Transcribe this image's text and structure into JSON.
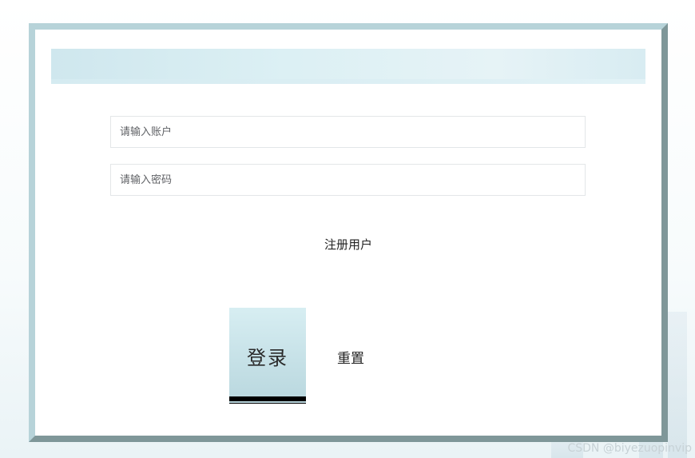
{
  "form": {
    "account_placeholder": "请输入账户",
    "password_placeholder": "请输入密码",
    "register_label": "注册用户",
    "login_label": "登录",
    "reset_label": "重置"
  },
  "watermark": "CSDN @biyezuopinvip",
  "colors": {
    "frame_light": "#b7d3d9",
    "frame_dark": "#7f9799",
    "banner": "#dcf0f4",
    "login_button": "#c6e1e7"
  }
}
